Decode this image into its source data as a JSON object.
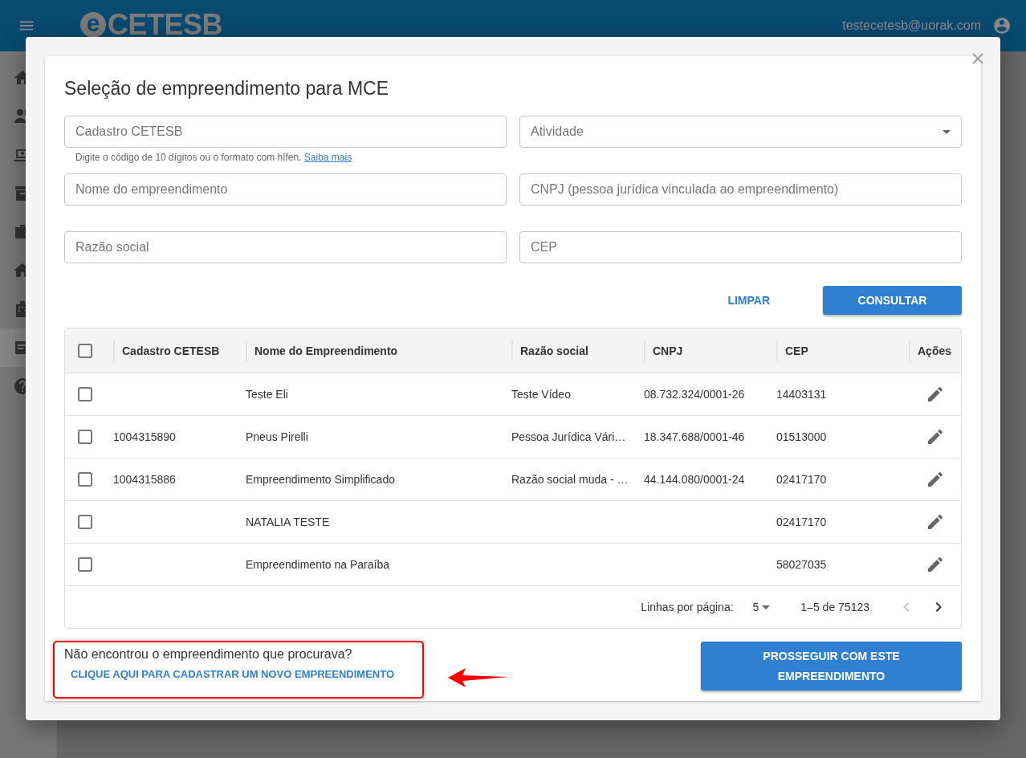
{
  "header": {
    "logo_letter": "e",
    "logo_text": "CETESB",
    "user_email": "testecetesb@uorak.com"
  },
  "sidebar": {
    "items": [
      {
        "kind": "home",
        "selected": false
      },
      {
        "kind": "person",
        "selected": false
      },
      {
        "kind": "laptop",
        "selected": false
      },
      {
        "kind": "archive",
        "selected": false
      },
      {
        "kind": "briefcase",
        "selected": false
      },
      {
        "kind": "house",
        "selected": false
      },
      {
        "kind": "building",
        "selected": false
      },
      {
        "kind": "card",
        "selected": true
      },
      {
        "kind": "help",
        "selected": false
      }
    ]
  },
  "dialog": {
    "title": "Seleção de empreendimento para MCE",
    "fields": [
      {
        "kind": "text",
        "placeholder": "Cadastro CETESB",
        "hint": {
          "text": "Digite o código de 10 dígitos ou o formato com hífen.",
          "link": "Saiba mais"
        }
      },
      {
        "kind": "select",
        "placeholder": "Atividade"
      },
      {
        "kind": "text",
        "placeholder": "Nome do empreendimento"
      },
      {
        "kind": "text",
        "placeholder": "CNPJ (pessoa jurídica vinculada ao empreendimento)"
      },
      {
        "kind": "text",
        "placeholder": "Razão social"
      },
      {
        "kind": "text",
        "placeholder": "CEP"
      }
    ],
    "buttons": [
      {
        "kind": "text",
        "label": "LIMPAR"
      },
      {
        "kind": "primary",
        "label": "CONSULTAR"
      }
    ],
    "table": {
      "select_all_checked": false,
      "columns": [
        "Cadastro CETESB",
        "Nome do Empreendimento",
        "Razão social",
        "CNPJ",
        "CEP",
        "Ações"
      ],
      "rows": [
        {
          "checked": false,
          "cells": [
            "",
            "Teste Eli",
            "Teste Vídeo",
            "08.732.324/0001-26",
            "14403131"
          ]
        },
        {
          "checked": false,
          "cells": [
            "1004315890",
            "Pneus Pirelli",
            "Pessoa Jurídica Vári…",
            "18.347.688/0001-46",
            "01513000"
          ]
        },
        {
          "checked": false,
          "cells": [
            "1004315886",
            "Empreendimento Simplificado",
            "Razão social muda - …",
            "44.144.080/0001-24",
            "02417170"
          ]
        },
        {
          "checked": false,
          "cells": [
            "",
            "NATALIA TESTE",
            "",
            "",
            "02417170"
          ]
        },
        {
          "checked": false,
          "cells": [
            "",
            "Empreendimento na Paraíba",
            "",
            "",
            "58027035"
          ]
        }
      ],
      "pagination": {
        "rows_label": "Linhas por página:",
        "rows_value": "5",
        "range": "1–5 de 75123",
        "prev_disabled": true,
        "next_disabled": false
      }
    },
    "footer": {
      "question": "Não encontrou o empreendimento que procurava?",
      "link": "CLIQUE AQUI PARA CADASTRAR UM NOVO EMPREENDIMENTO",
      "proceed_button": "PROSSEGUIR COM ESTE EMPREENDIMENTO"
    }
  }
}
